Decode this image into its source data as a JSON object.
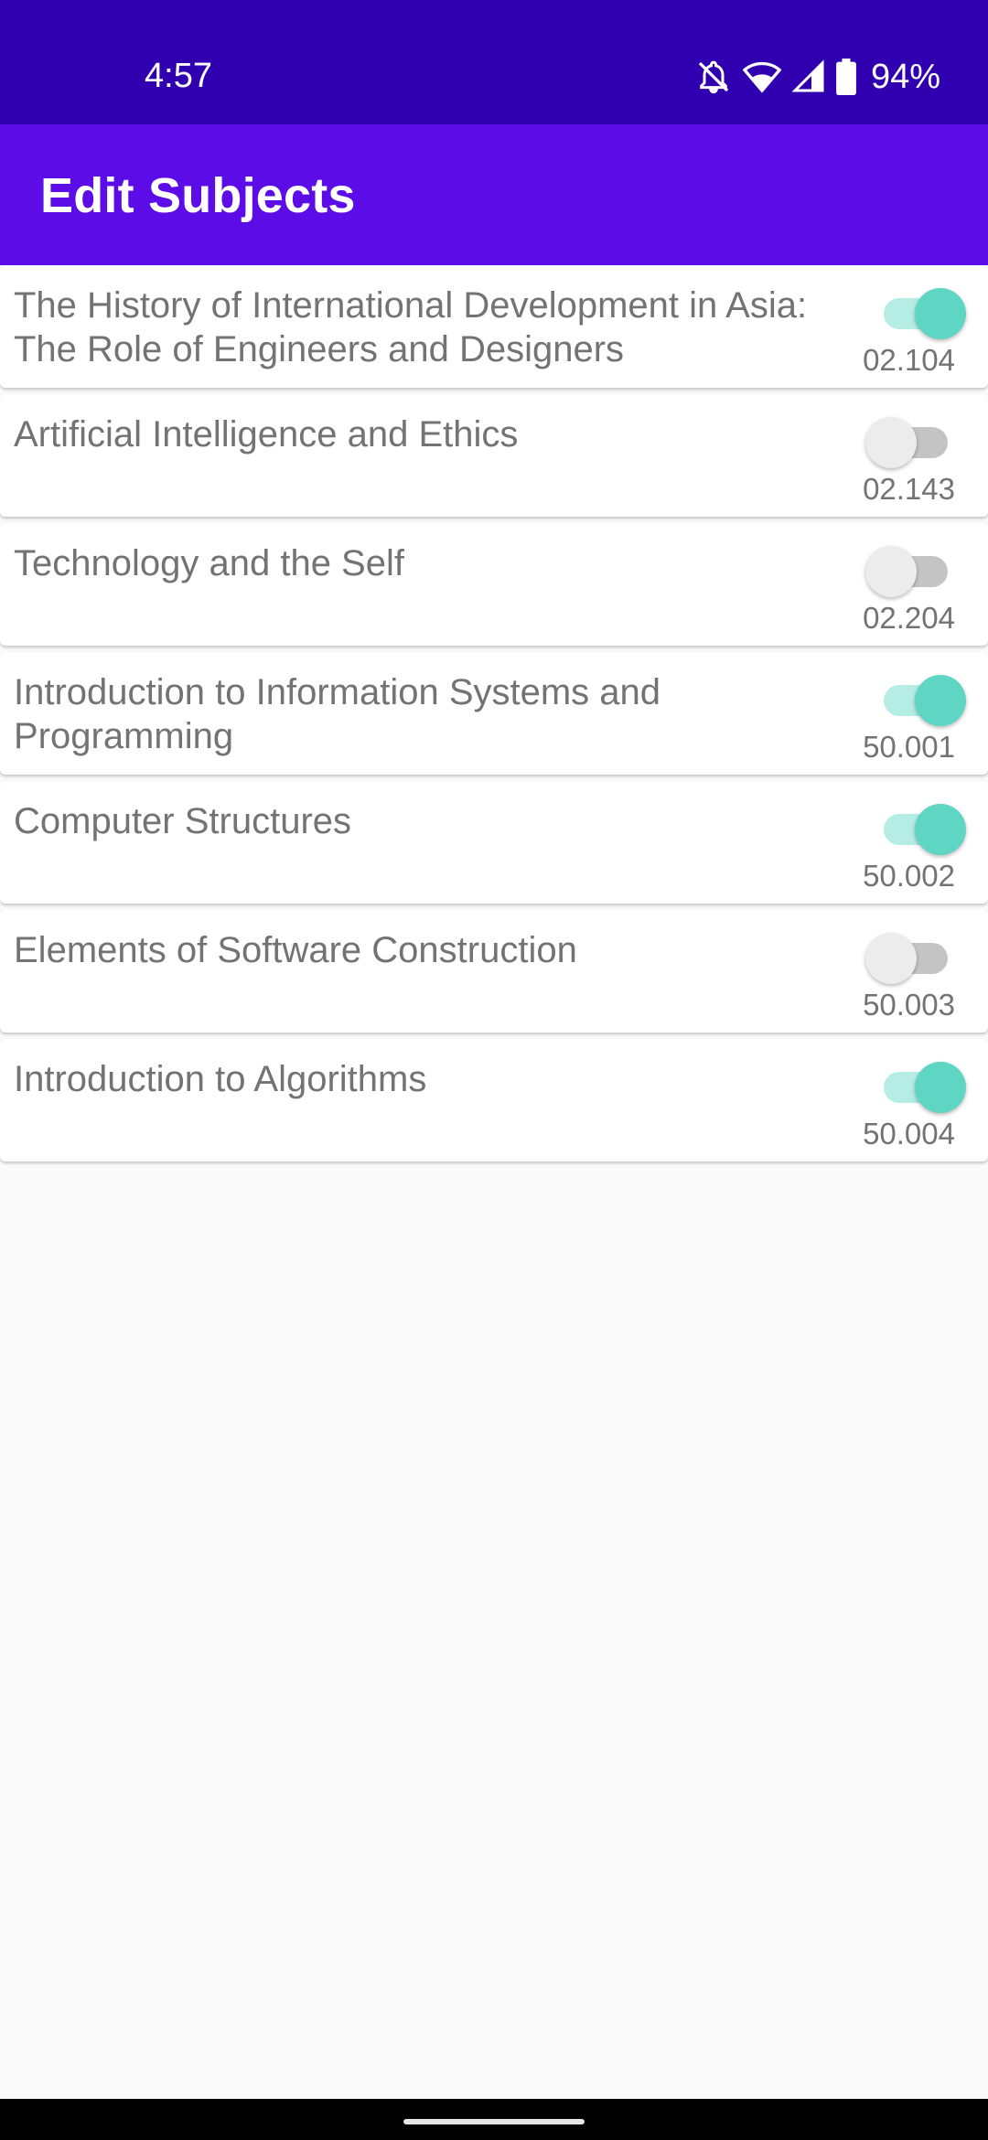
{
  "status_bar": {
    "time": "4:57",
    "battery": "94%",
    "icons": [
      "bell-off-icon",
      "wifi-icon",
      "signal-icon",
      "battery-icon"
    ]
  },
  "app_bar": {
    "title": "Edit Subjects"
  },
  "subjects": [
    {
      "title": "The History of International Development in Asia: The Role of Engineers and Designers",
      "code": "02.104",
      "enabled": true
    },
    {
      "title": "Artificial Intelligence and Ethics",
      "code": "02.143",
      "enabled": false
    },
    {
      "title": "Technology and the Self",
      "code": "02.204",
      "enabled": false
    },
    {
      "title": "Introduction to Information Systems and Programming",
      "code": "50.001",
      "enabled": true
    },
    {
      "title": "Computer Structures",
      "code": "50.002",
      "enabled": true
    },
    {
      "title": "Elements of Software Construction",
      "code": "50.003",
      "enabled": false
    },
    {
      "title": "Introduction to Algorithms",
      "code": "50.004",
      "enabled": true
    }
  ],
  "colors": {
    "status_bar": "#3000b0",
    "app_bar": "#5c0ce6",
    "switch_on_thumb": "#5fd6c3",
    "switch_on_track": "#b5ece4",
    "switch_off_thumb": "#ececec",
    "switch_off_track": "#c4c4c4",
    "text": "#737373",
    "background": "#fafafa"
  }
}
